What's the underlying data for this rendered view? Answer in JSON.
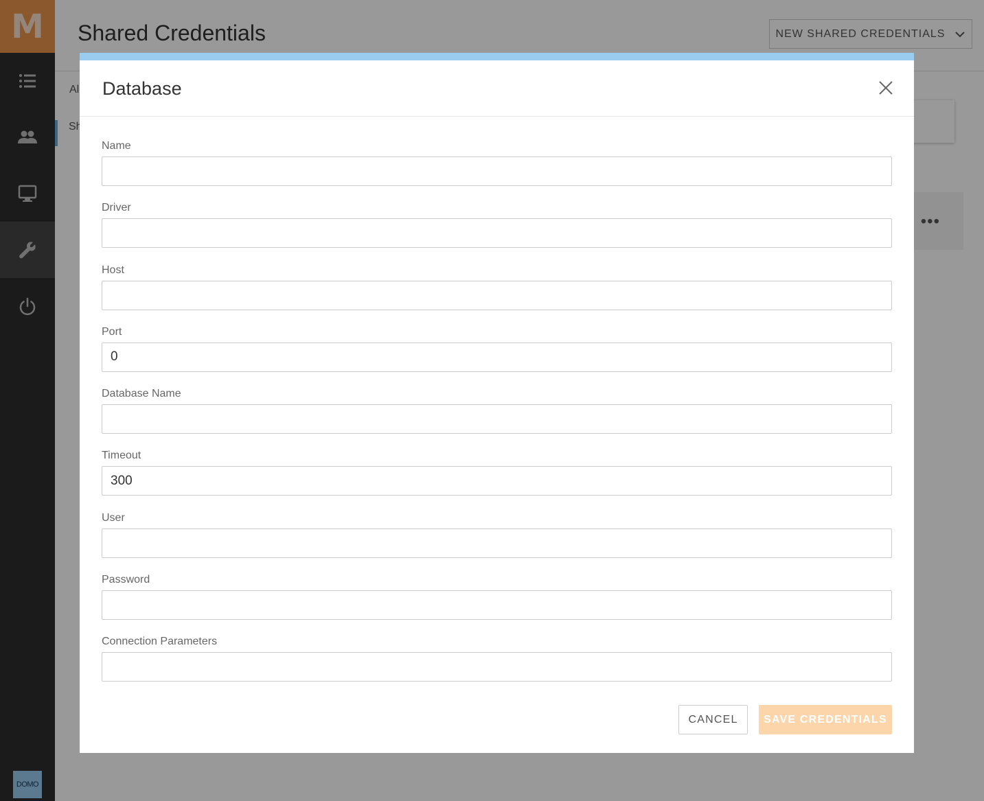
{
  "app": {
    "logo_letter": "M",
    "badge_label": "DOMO"
  },
  "sidebar": {
    "items": [
      {
        "name": "list-icon",
        "active": false
      },
      {
        "name": "users-icon",
        "active": false
      },
      {
        "name": "monitor-icon",
        "active": false
      },
      {
        "name": "wrench-icon",
        "active": true
      },
      {
        "name": "power-icon",
        "active": false
      }
    ]
  },
  "page": {
    "title": "Shared Credentials",
    "new_button_label": "NEW SHARED CREDENTIALS",
    "tab_1": "Al",
    "tab_2": "Sh"
  },
  "modal": {
    "title": "Database",
    "fields": {
      "name": {
        "label": "Name",
        "value": ""
      },
      "driver": {
        "label": "Driver",
        "value": ""
      },
      "host": {
        "label": "Host",
        "value": ""
      },
      "port": {
        "label": "Port",
        "value": "0"
      },
      "database_name": {
        "label": "Database Name",
        "value": ""
      },
      "timeout": {
        "label": "Timeout",
        "value": "300"
      },
      "user": {
        "label": "User",
        "value": ""
      },
      "password": {
        "label": "Password",
        "value": ""
      },
      "connection_parameters": {
        "label": "Connection Parameters",
        "value": ""
      }
    },
    "cancel_label": "CANCEL",
    "save_label": "SAVE CREDENTIALS"
  },
  "colors": {
    "logo_bg": "#e8924a",
    "modal_accent": "#99ccee",
    "save_button_disabled": "#fcd5ab",
    "sidebar_bg": "#2d2d2d"
  }
}
